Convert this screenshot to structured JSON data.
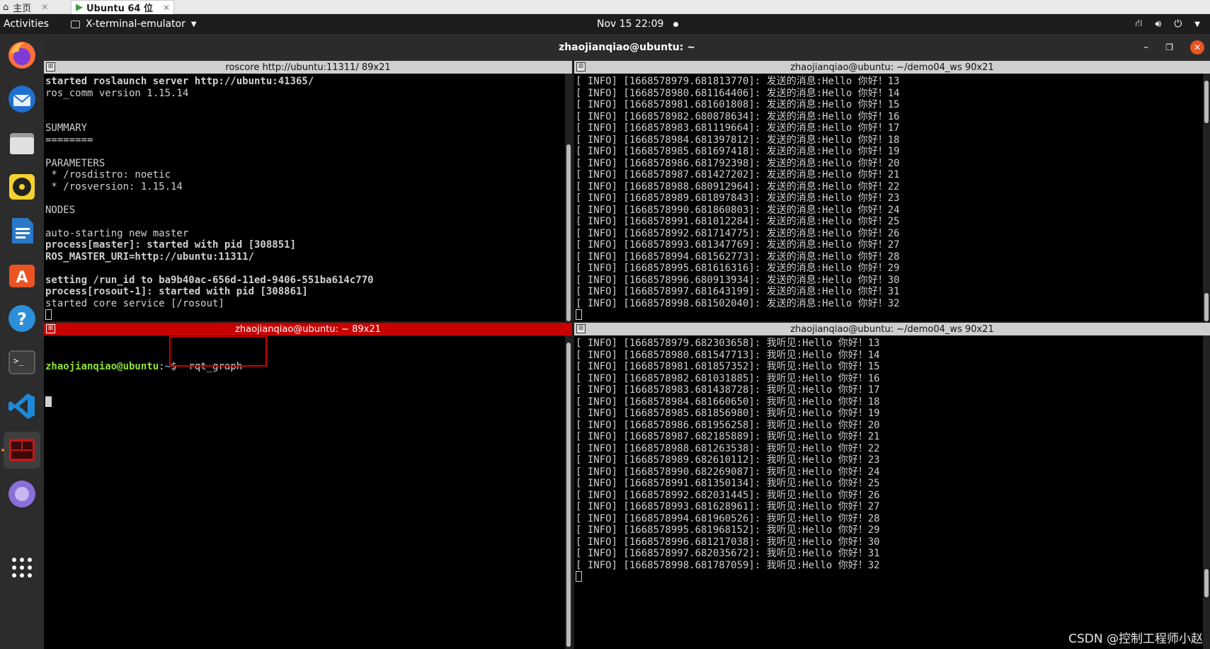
{
  "vm_tabs": {
    "home_label": "主页",
    "ubuntu_label": "Ubuntu 64 位"
  },
  "topbar": {
    "activities": "Activities",
    "app_name": "X-terminal-emulator",
    "clock": "Nov 15  22:09"
  },
  "window": {
    "title": "zhaojianqiao@ubuntu: ~"
  },
  "panes": {
    "top_left": {
      "title": "roscore http://ubuntu:11311/ 89x21",
      "lines": [
        {
          "text": "started roslaunch server http://ubuntu:41365/",
          "bold": true
        },
        {
          "text": "ros_comm version 1.15.14",
          "bold": false
        },
        {
          "text": "",
          "bold": false
        },
        {
          "text": "",
          "bold": false
        },
        {
          "text": "SUMMARY",
          "bold": false
        },
        {
          "text": "========",
          "bold": false
        },
        {
          "text": "",
          "bold": false
        },
        {
          "text": "PARAMETERS",
          "bold": false
        },
        {
          "text": " * /rosdistro: noetic",
          "bold": false
        },
        {
          "text": " * /rosversion: 1.15.14",
          "bold": false
        },
        {
          "text": "",
          "bold": false
        },
        {
          "text": "NODES",
          "bold": false
        },
        {
          "text": "",
          "bold": false
        },
        {
          "text": "auto-starting new master",
          "bold": false
        },
        {
          "text": "process[master]: started with pid [308851]",
          "bold": true
        },
        {
          "text": "ROS_MASTER_URI=http://ubuntu:11311/",
          "bold": true
        },
        {
          "text": "",
          "bold": false
        },
        {
          "text": "setting /run_id to ba9b40ac-656d-11ed-9406-551ba614c770",
          "bold": true
        },
        {
          "text": "process[rosout-1]: started with pid [308861]",
          "bold": true
        },
        {
          "text": "started core service [/rosout]",
          "bold": false
        }
      ]
    },
    "top_right": {
      "title": "zhaojianqiao@ubuntu: ~/demo04_ws 90x21",
      "lines": [
        "[ INFO] [1668578979.681813770]: 发送的消息:Hello 你好！13",
        "[ INFO] [1668578980.681164406]: 发送的消息:Hello 你好！14",
        "[ INFO] [1668578981.681601808]: 发送的消息:Hello 你好！15",
        "[ INFO] [1668578982.680878634]: 发送的消息:Hello 你好！16",
        "[ INFO] [1668578983.681119664]: 发送的消息:Hello 你好！17",
        "[ INFO] [1668578984.681397812]: 发送的消息:Hello 你好！18",
        "[ INFO] [1668578985.681697418]: 发送的消息:Hello 你好！19",
        "[ INFO] [1668578986.681792398]: 发送的消息:Hello 你好！20",
        "[ INFO] [1668578987.681427202]: 发送的消息:Hello 你好！21",
        "[ INFO] [1668578988.680912964]: 发送的消息:Hello 你好！22",
        "[ INFO] [1668578989.681897843]: 发送的消息:Hello 你好！23",
        "[ INFO] [1668578990.681860803]: 发送的消息:Hello 你好！24",
        "[ INFO] [1668578991.681012284]: 发送的消息:Hello 你好！25",
        "[ INFO] [1668578992.681714775]: 发送的消息:Hello 你好！26",
        "[ INFO] [1668578993.681347769]: 发送的消息:Hello 你好！27",
        "[ INFO] [1668578994.681562773]: 发送的消息:Hello 你好！28",
        "[ INFO] [1668578995.681616316]: 发送的消息:Hello 你好！29",
        "[ INFO] [1668578996.680913934]: 发送的消息:Hello 你好！30",
        "[ INFO] [1668578997.681643199]: 发送的消息:Hello 你好！31",
        "[ INFO] [1668578998.681502040]: 发送的消息:Hello 你好！32"
      ]
    },
    "bottom_left": {
      "title": "zhaojianqiao@ubuntu: ~ 89x21",
      "prompt_user": "zhaojianqiao@ubuntu",
      "prompt_sep": ":",
      "prompt_path": "~",
      "prompt_dollar": "$",
      "command": "  rqt_graph"
    },
    "bottom_right": {
      "title": "zhaojianqiao@ubuntu: ~/demo04_ws 90x21",
      "lines": [
        "[ INFO] [1668578979.682303658]: 我听见:Hello 你好！13",
        "[ INFO] [1668578980.681547713]: 我听见:Hello 你好！14",
        "[ INFO] [1668578981.681857352]: 我听见:Hello 你好！15",
        "[ INFO] [1668578982.681031885]: 我听见:Hello 你好！16",
        "[ INFO] [1668578983.681438728]: 我听见:Hello 你好！17",
        "[ INFO] [1668578984.681660650]: 我听见:Hello 你好！18",
        "[ INFO] [1668578985.681856980]: 我听见:Hello 你好！19",
        "[ INFO] [1668578986.681956258]: 我听见:Hello 你好！20",
        "[ INFO] [1668578987.682185889]: 我听见:Hello 你好！21",
        "[ INFO] [1668578988.681263538]: 我听见:Hello 你好！22",
        "[ INFO] [1668578989.682610112]: 我听见:Hello 你好！23",
        "[ INFO] [1668578990.682269087]: 我听见:Hello 你好！24",
        "[ INFO] [1668578991.681350134]: 我听见:Hello 你好！25",
        "[ INFO] [1668578992.682031445]: 我听见:Hello 你好！26",
        "[ INFO] [1668578993.681628961]: 我听见:Hello 你好！27",
        "[ INFO] [1668578994.681960526]: 我听见:Hello 你好！28",
        "[ INFO] [1668578995.681968152]: 我听见:Hello 你好！29",
        "[ INFO] [1668578996.681217038]: 我听见:Hello 你好！30",
        "[ INFO] [1668578997.682035672]: 我听见:Hello 你好！31",
        "[ INFO] [1668578998.681787059]: 我听见:Hello 你好！32"
      ]
    }
  },
  "dock": {
    "items": [
      "firefox-icon",
      "thunderbird-icon",
      "files-icon",
      "rhythmbox-icon",
      "writer-icon",
      "software-icon",
      "help-icon",
      "terminal-icon",
      "vscode-icon",
      "terminator-icon",
      "app-icon"
    ]
  },
  "watermark": "CSDN @控制工程师小赵",
  "colors": {
    "active_title": "#c80000",
    "prompt_user": "#8ae234",
    "prompt_path": "#729fcf",
    "ubuntu_orange": "#e95420"
  }
}
